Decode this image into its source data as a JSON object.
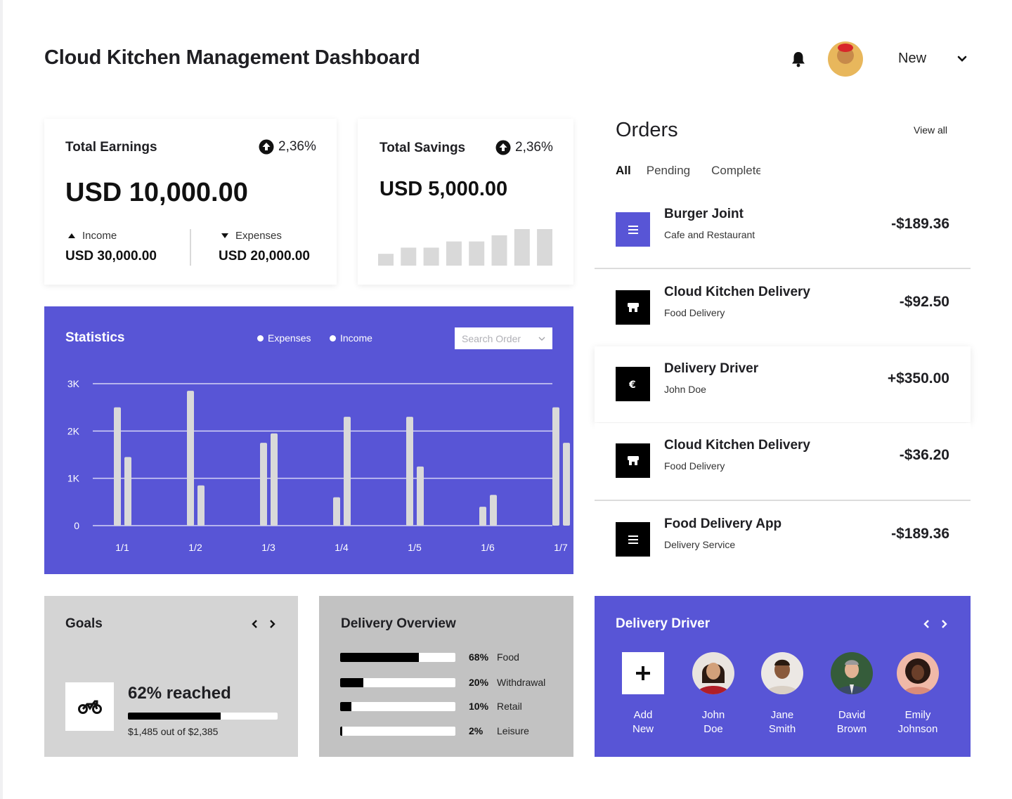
{
  "header": {
    "title": "Cloud Kitchen Management Dashboard",
    "user_label": "New",
    "icons": [
      "bell-icon",
      "chevron-down-icon"
    ]
  },
  "earnings": {
    "title": "Total Earnings",
    "change": "2,36%",
    "amount": "USD 10,000.00",
    "income_label": "Income",
    "income_value": "USD 30,000.00",
    "expenses_label": "Expenses",
    "expenses_value": "USD 20,000.00"
  },
  "savings": {
    "title": "Total Savings",
    "change": "2,36%",
    "amount": "USD 5,000.00",
    "bar_values": [
      1,
      2,
      2,
      3,
      3,
      4,
      5,
      5
    ]
  },
  "statistics": {
    "title": "Statistics",
    "legend": [
      "Expenses",
      "Income"
    ],
    "search_placeholder": "Search Order",
    "colors": {
      "background": "#5855d6",
      "bars": "#d9d9d9"
    }
  },
  "chart_data": {
    "type": "bar",
    "categories": [
      "1/1",
      "1/2",
      "1/3",
      "1/4",
      "1/5",
      "1/6",
      "1/7"
    ],
    "series": [
      {
        "name": "Expenses",
        "values": [
          2500,
          2850,
          1750,
          600,
          2300,
          400,
          2500
        ]
      },
      {
        "name": "Income",
        "values": [
          1450,
          850,
          1950,
          2300,
          1250,
          650,
          1750
        ]
      }
    ],
    "yticks": [
      "0",
      "1K",
      "2K",
      "3K"
    ],
    "ylim": [
      0,
      3000
    ],
    "grid": true
  },
  "orders": {
    "title": "Orders",
    "view_all": "View all",
    "tabs": [
      "All",
      "Pending",
      "Completed"
    ],
    "items": [
      {
        "name": "Burger Joint",
        "sub": "Cafe and Restaurant",
        "amount": "-$189.36",
        "icon": "menu-icon"
      },
      {
        "name": "Cloud Kitchen Delivery",
        "sub": "Food Delivery",
        "amount": "-$92.50",
        "icon": "store-icon"
      },
      {
        "name": "Delivery Driver",
        "sub": "John Doe",
        "amount": "+$350.00",
        "icon": "euro-icon"
      },
      {
        "name": "Cloud Kitchen Delivery",
        "sub": "Food Delivery",
        "amount": "-$36.20",
        "icon": "store-icon"
      },
      {
        "name": "Food Delivery App",
        "sub": "Delivery Service",
        "amount": "-$189.36",
        "icon": "menu-icon"
      }
    ]
  },
  "goals": {
    "title": "Goals",
    "reached": "62% reached",
    "progress": 0.62,
    "sub": "$1,485 out of $2,385"
  },
  "delivery_overview": {
    "title": "Delivery Overview",
    "rows": [
      {
        "pct": "68%",
        "label": "Food",
        "value": 0.68
      },
      {
        "pct": "20%",
        "label": "Withdrawal",
        "value": 0.2
      },
      {
        "pct": "10%",
        "label": "Retail",
        "value": 0.1
      },
      {
        "pct": "2%",
        "label": "Leisure",
        "value": 0.02
      }
    ]
  },
  "drivers": {
    "title": "Delivery Driver",
    "add_first": "Add",
    "add_last": "New",
    "people": [
      {
        "first": "John",
        "last": "Doe"
      },
      {
        "first": "Jane",
        "last": "Smith"
      },
      {
        "first": "David",
        "last": "Brown"
      },
      {
        "first": "Emily",
        "last": "Johnson"
      }
    ]
  }
}
